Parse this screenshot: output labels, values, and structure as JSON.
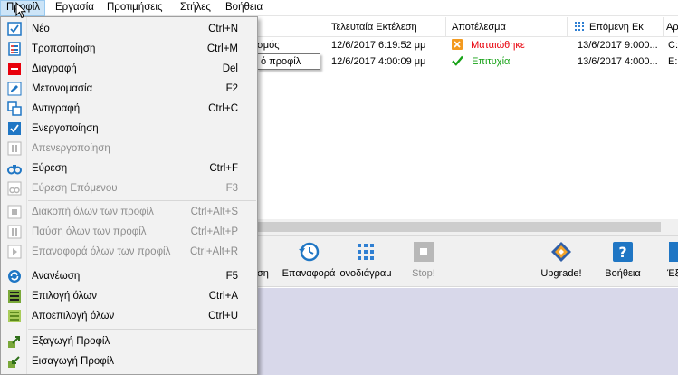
{
  "menubar": {
    "items": [
      "Προφίλ",
      "Εργασία",
      "Προτιμήσεις",
      "Στήλες",
      "Βοήθεια"
    ]
  },
  "list": {
    "headers": [
      "Τελευταία Εκτέλεση",
      "Αποτέλεσμα",
      "Επόμενη Εκ",
      "Αρ"
    ],
    "rows": [
      {
        "name": "σμός",
        "last": "12/6/2017 6:19:52 μμ",
        "result": "Ματαιώθηκε",
        "next": "13/6/2017 9:000...",
        "path": "C:"
      },
      {
        "name": "",
        "last": "12/6/2017 4:00:09 μμ",
        "result": "Επιτυχία",
        "next": "13/6/2017 4:000...",
        "path": "E:"
      }
    ],
    "tooltip": "ό προφίλ"
  },
  "toolbar": {
    "items": [
      "ση",
      "Επαναφορά",
      "ονοδιάγραμ",
      "Stop!",
      "Upgrade!",
      "Βοήθεια",
      "Έξ"
    ]
  },
  "menu": {
    "items": [
      {
        "label": "Νέο",
        "shortcut": "Ctrl+N",
        "icon": "new-profile-icon",
        "disabled": false
      },
      {
        "label": "Τροποποίηση",
        "shortcut": "Ctrl+M",
        "icon": "edit-profile-icon",
        "disabled": false
      },
      {
        "label": "Διαγραφή",
        "shortcut": "Del",
        "icon": "delete-icon",
        "disabled": false
      },
      {
        "label": "Μετονομασία",
        "shortcut": "F2",
        "icon": "rename-pencil-icon",
        "disabled": false
      },
      {
        "label": "Αντιγραφή",
        "shortcut": "Ctrl+C",
        "icon": "copy-icon",
        "disabled": false
      },
      {
        "label": "Ενεργοποίηση",
        "shortcut": "",
        "icon": "checkbox-checked-icon",
        "disabled": false
      },
      {
        "label": "Απενεργοποίηση",
        "shortcut": "",
        "icon": "pause-icon",
        "disabled": true
      },
      {
        "label": "Εύρεση",
        "shortcut": "Ctrl+F",
        "icon": "binoculars-icon",
        "disabled": false
      },
      {
        "label": "Εύρεση Επόμενου",
        "shortcut": "F3",
        "icon": "find-next-icon",
        "disabled": true
      },
      {
        "label": "Διακοπή όλων των προφίλ",
        "shortcut": "Ctrl+Alt+S",
        "icon": "stop-all-icon",
        "disabled": true
      },
      {
        "label": "Παύση όλων των προφίλ",
        "shortcut": "Ctrl+Alt+P",
        "icon": "pause-all-icon",
        "disabled": true
      },
      {
        "label": "Επαναφορά όλων των προφίλ",
        "shortcut": "Ctrl+Alt+R",
        "icon": "resume-all-icon",
        "disabled": true
      },
      {
        "label": "Ανανέωση",
        "shortcut": "F5",
        "icon": "refresh-icon",
        "disabled": false
      },
      {
        "label": "Επιλογή όλων",
        "shortcut": "Ctrl+A",
        "icon": "select-all-icon",
        "disabled": false
      },
      {
        "label": "Αποεπιλογή όλων",
        "shortcut": "Ctrl+U",
        "icon": "deselect-all-icon",
        "disabled": false
      },
      {
        "label": "Εξαγωγή Προφίλ",
        "shortcut": "",
        "icon": "export-icon",
        "disabled": false
      },
      {
        "label": "Εισαγωγή Προφίλ",
        "shortcut": "",
        "icon": "import-icon",
        "disabled": false
      }
    ]
  },
  "colors": {
    "failed": "#e8000b",
    "success": "#17a217",
    "menu_bg": "#f2f2f2",
    "menubar_active": "#cce4f7"
  }
}
